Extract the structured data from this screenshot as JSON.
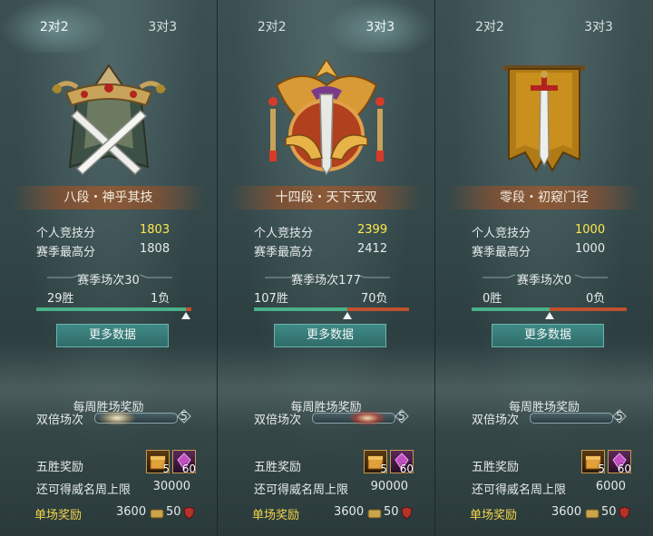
{
  "tabs": [
    "2对2",
    "3对3"
  ],
  "labels": {
    "personal_score": "个人竞技分",
    "season_best": "赛季最高分",
    "more_data": "更多数据",
    "weekly_reward": "每周胜场奖励",
    "double_matches": "双倍场次",
    "five_win_reward": "五胜奖励",
    "fame_cap": "还可得威名周上限",
    "single_reward": "单场奖励"
  },
  "colors": {
    "win_bar": "#49b08a",
    "loss_bar": "#c0502e",
    "score_highlight": "#ffe94a",
    "reward_label": "#f3d64a",
    "button": "#3a7f7c"
  },
  "panels": [
    {
      "active_tab": 0,
      "emblem": "crossed-swords-crown-emblem",
      "rank_title": "八段・神乎其技",
      "personal_score": "1803",
      "season_best": "1808",
      "season_matches": "赛季场次30",
      "wins": "29胜",
      "losses": "1负",
      "win_ratio": 0.967,
      "double_count": "5",
      "double_progress": 0.2,
      "items": [
        {
          "icon": "gold-chest-icon",
          "count": "5"
        },
        {
          "icon": "purple-gem-icon",
          "count": "60"
        }
      ],
      "fame_cap": "30000",
      "single_coin": "3600",
      "single_token": "50"
    },
    {
      "active_tab": 1,
      "emblem": "phoenix-crest-emblem",
      "rank_title": "十四段・天下无双",
      "personal_score": "2399",
      "season_best": "2412",
      "season_matches": "赛季场次177",
      "wins": "107胜",
      "losses": "70负",
      "win_ratio": 0.605,
      "double_count": "5",
      "double_progress": 0.6,
      "items": [
        {
          "icon": "gold-chest-icon",
          "count": "5"
        },
        {
          "icon": "purple-gem-icon",
          "count": "60"
        }
      ],
      "fame_cap": "90000",
      "single_coin": "3600",
      "single_token": "50"
    },
    {
      "active_tab": -1,
      "emblem": "banner-sword-emblem",
      "rank_title": "零段・初窥门径",
      "personal_score": "1000",
      "season_best": "1000",
      "season_matches": "赛季场次0",
      "wins": "0胜",
      "losses": "0负",
      "win_ratio": 0.5,
      "double_count": "5",
      "double_progress": 0.0,
      "items": [
        {
          "icon": "gold-chest-icon",
          "count": "5"
        },
        {
          "icon": "purple-gem-icon",
          "count": "60"
        }
      ],
      "fame_cap": "6000",
      "single_coin": "3600",
      "single_token": "50"
    }
  ]
}
